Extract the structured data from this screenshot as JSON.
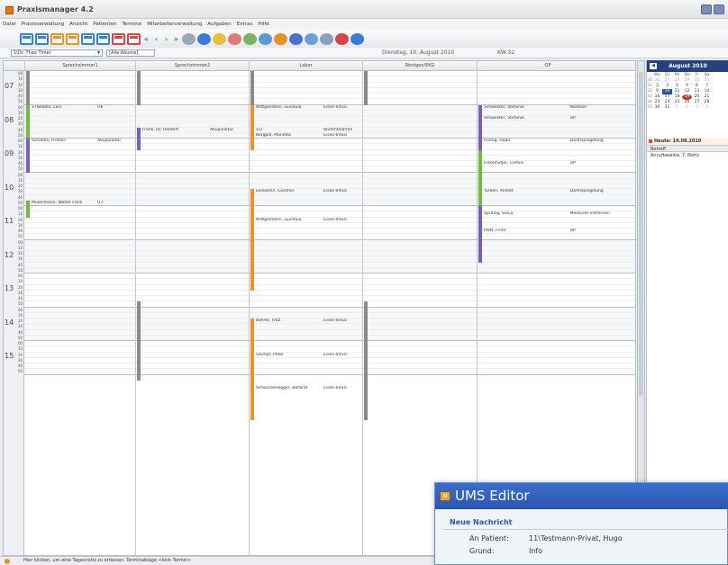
{
  "window": {
    "title": "Praxismanager 4.2"
  },
  "menu": [
    "Datei",
    "Praxisverwaltung",
    "Ansicht",
    "Patienten",
    "Termine",
    "Mitarbeiterverwaltung",
    "Aufgaben",
    "Extras",
    "Hilfe"
  ],
  "toolbar": {
    "icons": [
      "day-calendar",
      "week-calendar",
      "work-week-calendar",
      "month-calendar",
      "calendar-view-5",
      "calendar-view-6",
      "calendar-view-7",
      "calendar-view-8",
      "first",
      "previous",
      "next",
      "last",
      "tool-1",
      "tool-2",
      "tool-3",
      "tool-4",
      "tool-5",
      "tool-6",
      "tool-7",
      "tool-8",
      "tool-9",
      "tool-10",
      "search",
      "help"
    ]
  },
  "selection": {
    "doctor": "1\\Dr. Theo Timer",
    "room": "[Alle Räume]",
    "date": "Dienstag, 10. August 2010",
    "week": "KW 32"
  },
  "calendar": {
    "columns": [
      {
        "name": "Sprechzimmer1"
      },
      {
        "name": "Sprechzimmer2"
      },
      {
        "name": "Labor"
      },
      {
        "name": "Röntgen/EKG"
      },
      {
        "name": "OP"
      }
    ],
    "hours": [
      "07",
      "08",
      "09",
      "10",
      "11",
      "12",
      "13",
      "14",
      "15"
    ],
    "minutes": [
      "00",
      "10",
      "20",
      "30",
      "40",
      "50"
    ],
    "appointments": [
      {
        "col": 0,
        "slot": 6,
        "name": "17\\Blabla, Lars",
        "reason": "U6"
      },
      {
        "col": 0,
        "slot": 12,
        "name": "Schatzle, Fridolin",
        "reason": "Akupunktur"
      },
      {
        "col": 0,
        "slot": 23,
        "name": "Musermann, Walter Frodi",
        "reason": "U7"
      },
      {
        "col": 1,
        "slot": 10,
        "name": "Frank, Dr. Herbert",
        "reason": "Akupunktur"
      },
      {
        "col": 2,
        "slot": 6,
        "name": "Wittgenstein, Gundula",
        "reason": "Eisen-Infusi"
      },
      {
        "col": 2,
        "slot": 10,
        "name": "1\\2",
        "reason": "Blutentnahme"
      },
      {
        "col": 2,
        "slot": 11,
        "name": "Bergpol, Manetta",
        "reason": "Eisen-Infusi"
      },
      {
        "col": 2,
        "slot": 21,
        "name": "Leiewann, Günther",
        "reason": "Eisen-Infusi"
      },
      {
        "col": 2,
        "slot": 26,
        "name": "Wittgenstein, Gundula",
        "reason": "Eisen-Infusi"
      },
      {
        "col": 2,
        "slot": 44,
        "name": "Bohrer, Fritz",
        "reason": "Eisen-Infusi"
      },
      {
        "col": 2,
        "slot": 50,
        "name": "Stumpf, Peter",
        "reason": "Eisen-Infusi"
      },
      {
        "col": 2,
        "slot": 56,
        "name": "Schwarzenegger, Berbrat",
        "reason": "Eisen-Infusi"
      },
      {
        "col": 4,
        "slot": 6,
        "name": "Schwester, Stefanie",
        "reason": "Narkose"
      },
      {
        "col": 4,
        "slot": 8,
        "name": "Schwester, Stefanie",
        "reason": "OP"
      },
      {
        "col": 4,
        "slot": 12,
        "name": "Cheng, Huan",
        "reason": "Darmspiegelung"
      },
      {
        "col": 4,
        "slot": 16,
        "name": "Finkelhuber, Cemini",
        "reason": "OP"
      },
      {
        "col": 4,
        "slot": 21,
        "name": "Türken, Ahmet",
        "reason": "Darmspiegelung"
      },
      {
        "col": 4,
        "slot": 25,
        "name": "Spritzig, Sonja",
        "reason": "Melanom entfernen"
      },
      {
        "col": 4,
        "slot": 28,
        "name": "Platt, Frida",
        "reason": "OP"
      }
    ],
    "bars": [
      {
        "col": 0,
        "from": 0,
        "to": 6,
        "color": "#8a8a8a"
      },
      {
        "col": 0,
        "from": 6,
        "to": 12,
        "color": "#6bbf3d"
      },
      {
        "col": 0,
        "from": 12,
        "to": 18,
        "color": "#7a5cc4"
      },
      {
        "col": 0,
        "from": 23,
        "to": 26,
        "color": "#6bbf3d"
      },
      {
        "col": 1,
        "from": 0,
        "to": 6,
        "color": "#8a8a8a"
      },
      {
        "col": 1,
        "from": 10,
        "to": 14,
        "color": "#7a5cc4"
      },
      {
        "col": 1,
        "from": 41,
        "to": 55,
        "color": "#8a8a8a"
      },
      {
        "col": 2,
        "from": 0,
        "to": 6,
        "color": "#8a8a8a"
      },
      {
        "col": 2,
        "from": 6,
        "to": 14,
        "color": "#f0922c"
      },
      {
        "col": 2,
        "from": 21,
        "to": 39,
        "color": "#f0922c"
      },
      {
        "col": 2,
        "from": 44,
        "to": 62,
        "color": "#f0922c"
      },
      {
        "col": 3,
        "from": 0,
        "to": 6,
        "color": "#8a8a8a"
      },
      {
        "col": 3,
        "from": 41,
        "to": 62,
        "color": "#8a8a8a"
      },
      {
        "col": 4,
        "from": 6,
        "to": 14,
        "color": "#7a5cc4"
      },
      {
        "col": 4,
        "from": 14,
        "to": 24,
        "color": "#6bbf3d"
      },
      {
        "col": 4,
        "from": 24,
        "to": 34,
        "color": "#7a5cc4"
      }
    ]
  },
  "mini_calendar": {
    "month": "August 2010",
    "weekdays": [
      "Mo",
      "Di",
      "Mi",
      "Do",
      "Fr",
      "Sa"
    ],
    "weeks": [
      {
        "wk": "30",
        "days": [
          "26",
          "27",
          "28",
          "29",
          "30",
          "31"
        ]
      },
      {
        "wk": "31",
        "days": [
          "2",
          "3",
          "4",
          "5",
          "6",
          "7"
        ]
      },
      {
        "wk": "32",
        "days": [
          "9",
          "10",
          "11",
          "12",
          "13",
          "14"
        ]
      },
      {
        "wk": "33",
        "days": [
          "16",
          "17",
          "18",
          "19",
          "20",
          "21"
        ]
      },
      {
        "wk": "34",
        "days": [
          "23",
          "24",
          "25",
          "26",
          "27",
          "28"
        ]
      },
      {
        "wk": "35",
        "days": [
          "30",
          "31",
          "1",
          "2",
          "3",
          "4"
        ]
      }
    ],
    "today_label": "Heute: 19.08.2010",
    "betreff_header": "Betreff",
    "betreff_item": "Anrufbeantw. 7. Notiz"
  },
  "status": {
    "text": "Hier klicken, um eine Tagesnotiz zu erfassen. Terminablage <kein Termin>"
  },
  "ums_editor": {
    "title": "UMS Editor",
    "subtitle": "Neue Nachricht",
    "patient_label": "An Patient:",
    "patient_value": "11\\Testmann-Privat, Hugo",
    "reason_label": "Grund:",
    "reason_value": "Info"
  }
}
